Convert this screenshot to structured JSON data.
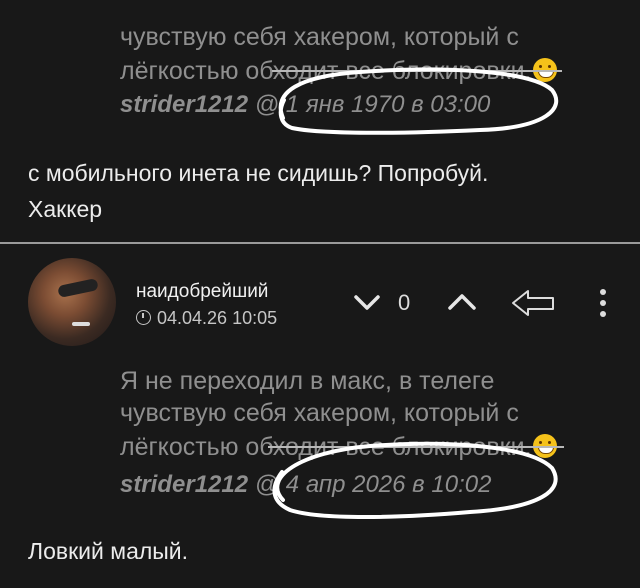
{
  "top_comment": {
    "quote_line_2": "чувствую себя хакером, который с",
    "quote_line_3": "лёгкостью обходит все блокировки.",
    "quote_author": "strider1212",
    "quote_at": " @ ",
    "quote_date": "1 янв 1970 в 03:00",
    "reply_line_1": "с мобильного инета не сидишь? Попробуй.",
    "reply_line_2": "Хаккер"
  },
  "second_comment": {
    "username": "наидобрейший",
    "timestamp": "04.04.26 10:05",
    "vote_score": "0",
    "quote_line_1": "Я не переходил в макс, в телеге",
    "quote_line_2": "чувствую себя хакером, который с",
    "quote_line_3": "лёгкостью обходит все блокировки.",
    "quote_author": "strider1212",
    "quote_at": " @ ",
    "quote_date": "4 апр 2026 в 10:02",
    "reply_line_1": "Ловкий малый."
  },
  "icons": {
    "downvote": "chevron-down-icon",
    "upvote": "chevron-up-icon",
    "reply": "reply-arrow-icon",
    "more": "more-vertical-icon",
    "clock": "clock-icon",
    "emoji": "grinning-face-icon"
  },
  "colors": {
    "background": "#181818",
    "quote_text": "#8f8f8f",
    "body_text": "#ececec",
    "annotation_circle": "#ffffff"
  }
}
